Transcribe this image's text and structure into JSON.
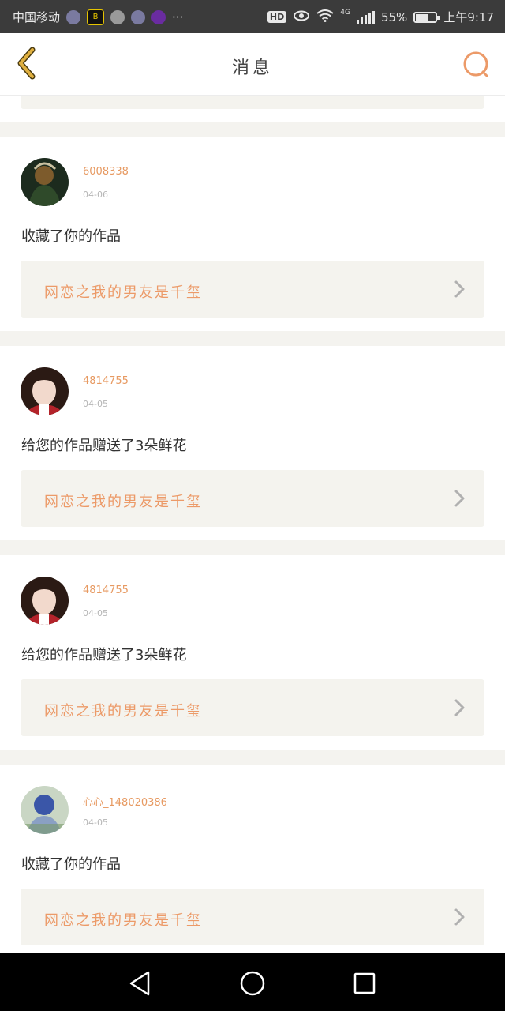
{
  "status_bar": {
    "carrier": "中国移动",
    "more": "···",
    "hd": "HD",
    "network": "4G",
    "battery": "55%",
    "time": "上午9:17"
  },
  "header": {
    "title": "消息"
  },
  "messages": [
    {
      "username": "6008338",
      "date": "04-06",
      "action": "收藏了你的作品",
      "work_title": "网恋之我的男友是千玺",
      "avatar_colors": [
        "#2f4a2a",
        "#7d5b2c",
        "#1c2b1e"
      ]
    },
    {
      "username": "4814755",
      "date": "04-05",
      "action": "给您的作品赠送了3朵鲜花",
      "work_title": "网恋之我的男友是千玺",
      "avatar_colors": [
        "#f2d9cc",
        "#2b1a14",
        "#b3232a"
      ]
    },
    {
      "username": "4814755",
      "date": "04-05",
      "action": "给您的作品赠送了3朵鲜花",
      "work_title": "网恋之我的男友是千玺",
      "avatar_colors": [
        "#f2d9cc",
        "#2b1a14",
        "#b3232a"
      ]
    },
    {
      "username": "心心_148020386",
      "date": "04-05",
      "action": "收藏了你的作品",
      "work_title": "网恋之我的男友是千玺",
      "avatar_colors": [
        "#c9d6c4",
        "#3a56a8",
        "#8aa0c4"
      ]
    }
  ],
  "colors": {
    "accent": "#ec9a68",
    "back_arrow": "#d9a63a",
    "page_bg": "#f4f3ef",
    "card_bg": "#ffffff"
  }
}
